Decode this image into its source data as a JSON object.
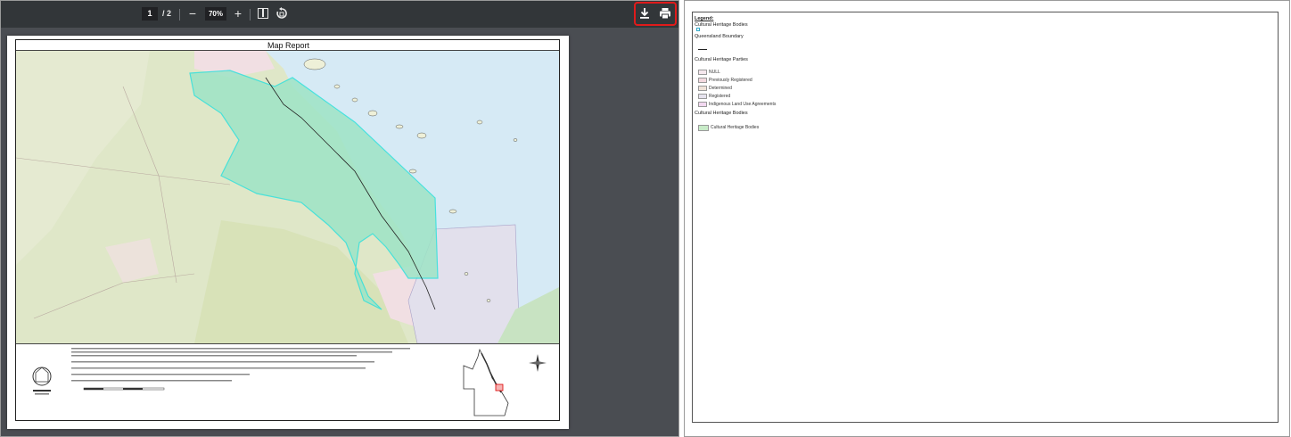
{
  "viewer": {
    "page_current": "1",
    "page_separator": "/ 2",
    "zoom_out_label": "−",
    "zoom_value": "70%",
    "zoom_in_label": "+"
  },
  "map": {
    "title": "Map Report"
  },
  "legend": {
    "title": "Legend:",
    "cultural_heritage_bodies_label": "Cultural Heritage Bodies",
    "queensland_boundary_label": "Queensland Boundary",
    "parties_heading": "Cultural Heritage Parties",
    "parties_items": [
      {
        "label": "NULL",
        "color": "#f6e8ee"
      },
      {
        "label": "Previously Registered",
        "color": "#f3d9df"
      },
      {
        "label": "Determined",
        "color": "#efe3d9"
      },
      {
        "label": "Registered",
        "color": "#e6e3ee"
      },
      {
        "label": "Indigenous Land Use Agreements",
        "color": "#f2d8f0"
      }
    ],
    "bodies_heading": "Cultural Heritage Bodies",
    "bodies_items": [
      {
        "label": "Cultural Heritage Bodies",
        "color": "#c8ebc8"
      }
    ]
  },
  "colors": {
    "highlight": "#e01b1b",
    "toolbar": "#323639",
    "viewer_bg": "#4a4d52",
    "sea": "#d6eaf5",
    "land": "#dfe7c8",
    "heritage_body": "#9ee4c6",
    "heritage_outline": "#2fe0dc"
  }
}
